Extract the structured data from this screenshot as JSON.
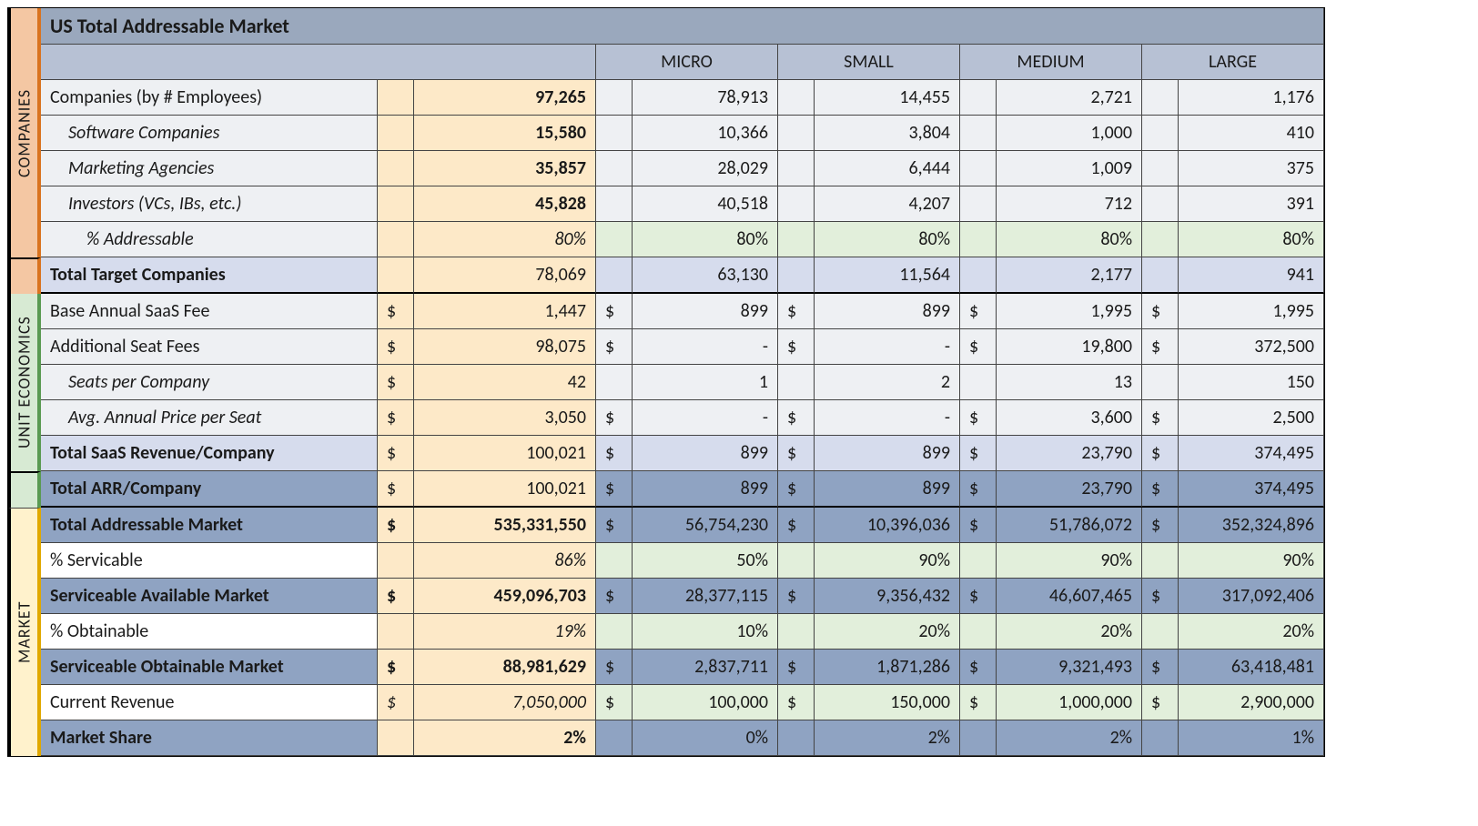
{
  "title": "US Total Addressable Market",
  "sections": {
    "companies": "COMPANIES",
    "unit": "UNIT ECONOMICS",
    "market": "MARKET"
  },
  "columns": [
    "MICRO",
    "SMALL",
    "MEDIUM",
    "LARGE"
  ],
  "rows": {
    "companies_by_emp": {
      "label": "Companies (by # Employees)",
      "total": "97,265",
      "micro": "78,913",
      "small": "14,455",
      "medium": "2,721",
      "large": "1,176"
    },
    "software_co": {
      "label": "Software Companies",
      "total": "15,580",
      "micro": "10,366",
      "small": "3,804",
      "medium": "1,000",
      "large": "410"
    },
    "marketing_ag": {
      "label": "Marketing Agencies",
      "total": "35,857",
      "micro": "28,029",
      "small": "6,444",
      "medium": "1,009",
      "large": "375"
    },
    "investors": {
      "label": "Investors (VCs, IBs, etc.)",
      "total": "45,828",
      "micro": "40,518",
      "small": "4,207",
      "medium": "712",
      "large": "391"
    },
    "pct_addressable": {
      "label": "% Addressable",
      "total": "80%",
      "micro": "80%",
      "small": "80%",
      "medium": "80%",
      "large": "80%"
    },
    "total_target": {
      "label": "Total Target Companies",
      "total": "78,069",
      "micro": "63,130",
      "small": "11,564",
      "medium": "2,177",
      "large": "941"
    },
    "base_fee": {
      "label": "Base Annual SaaS Fee",
      "total": "1,447",
      "micro": "899",
      "small": "899",
      "medium": "1,995",
      "large": "1,995"
    },
    "addl_seat": {
      "label": "Additional Seat Fees",
      "total": "98,075",
      "micro": "-",
      "small": "-",
      "medium": "19,800",
      "large": "372,500"
    },
    "seats_per": {
      "label": "Seats per Company",
      "total": "42",
      "micro": "1",
      "small": "2",
      "medium": "13",
      "large": "150"
    },
    "price_per_seat": {
      "label": "Avg. Annual Price per Seat",
      "total": "3,050",
      "micro": "-",
      "small": "-",
      "medium": "3,600",
      "large": "2,500"
    },
    "saas_rev_co": {
      "label": "Total SaaS Revenue/Company",
      "total": "100,021",
      "micro": "899",
      "small": "899",
      "medium": "23,790",
      "large": "374,495"
    },
    "arr_co": {
      "label": "Total ARR/Company",
      "total": "100,021",
      "micro": "899",
      "small": "899",
      "medium": "23,790",
      "large": "374,495"
    },
    "tam": {
      "label": "Total Addressable Market",
      "total": "535,331,550",
      "micro": "56,754,230",
      "small": "10,396,036",
      "medium": "51,786,072",
      "large": "352,324,896"
    },
    "pct_servicable": {
      "label": "% Servicable",
      "total": "86%",
      "micro": "50%",
      "small": "90%",
      "medium": "90%",
      "large": "90%"
    },
    "sam": {
      "label": "Serviceable Available Market",
      "total": "459,096,703",
      "micro": "28,377,115",
      "small": "9,356,432",
      "medium": "46,607,465",
      "large": "317,092,406"
    },
    "pct_obtainable": {
      "label": "% Obtainable",
      "total": "19%",
      "micro": "10%",
      "small": "20%",
      "medium": "20%",
      "large": "20%"
    },
    "som": {
      "label": "Serviceable Obtainable Market",
      "total": "88,981,629",
      "micro": "2,837,711",
      "small": "1,871,286",
      "medium": "9,321,493",
      "large": "63,418,481"
    },
    "current_rev": {
      "label": "Current Revenue",
      "total": "7,050,000",
      "micro": "100,000",
      "small": "150,000",
      "medium": "1,000,000",
      "large": "2,900,000"
    },
    "market_share": {
      "label": "Market Share",
      "total": "2%",
      "micro": "0%",
      "small": "2%",
      "medium": "2%",
      "large": "1%"
    }
  },
  "sym": {
    "dollar": "$"
  }
}
